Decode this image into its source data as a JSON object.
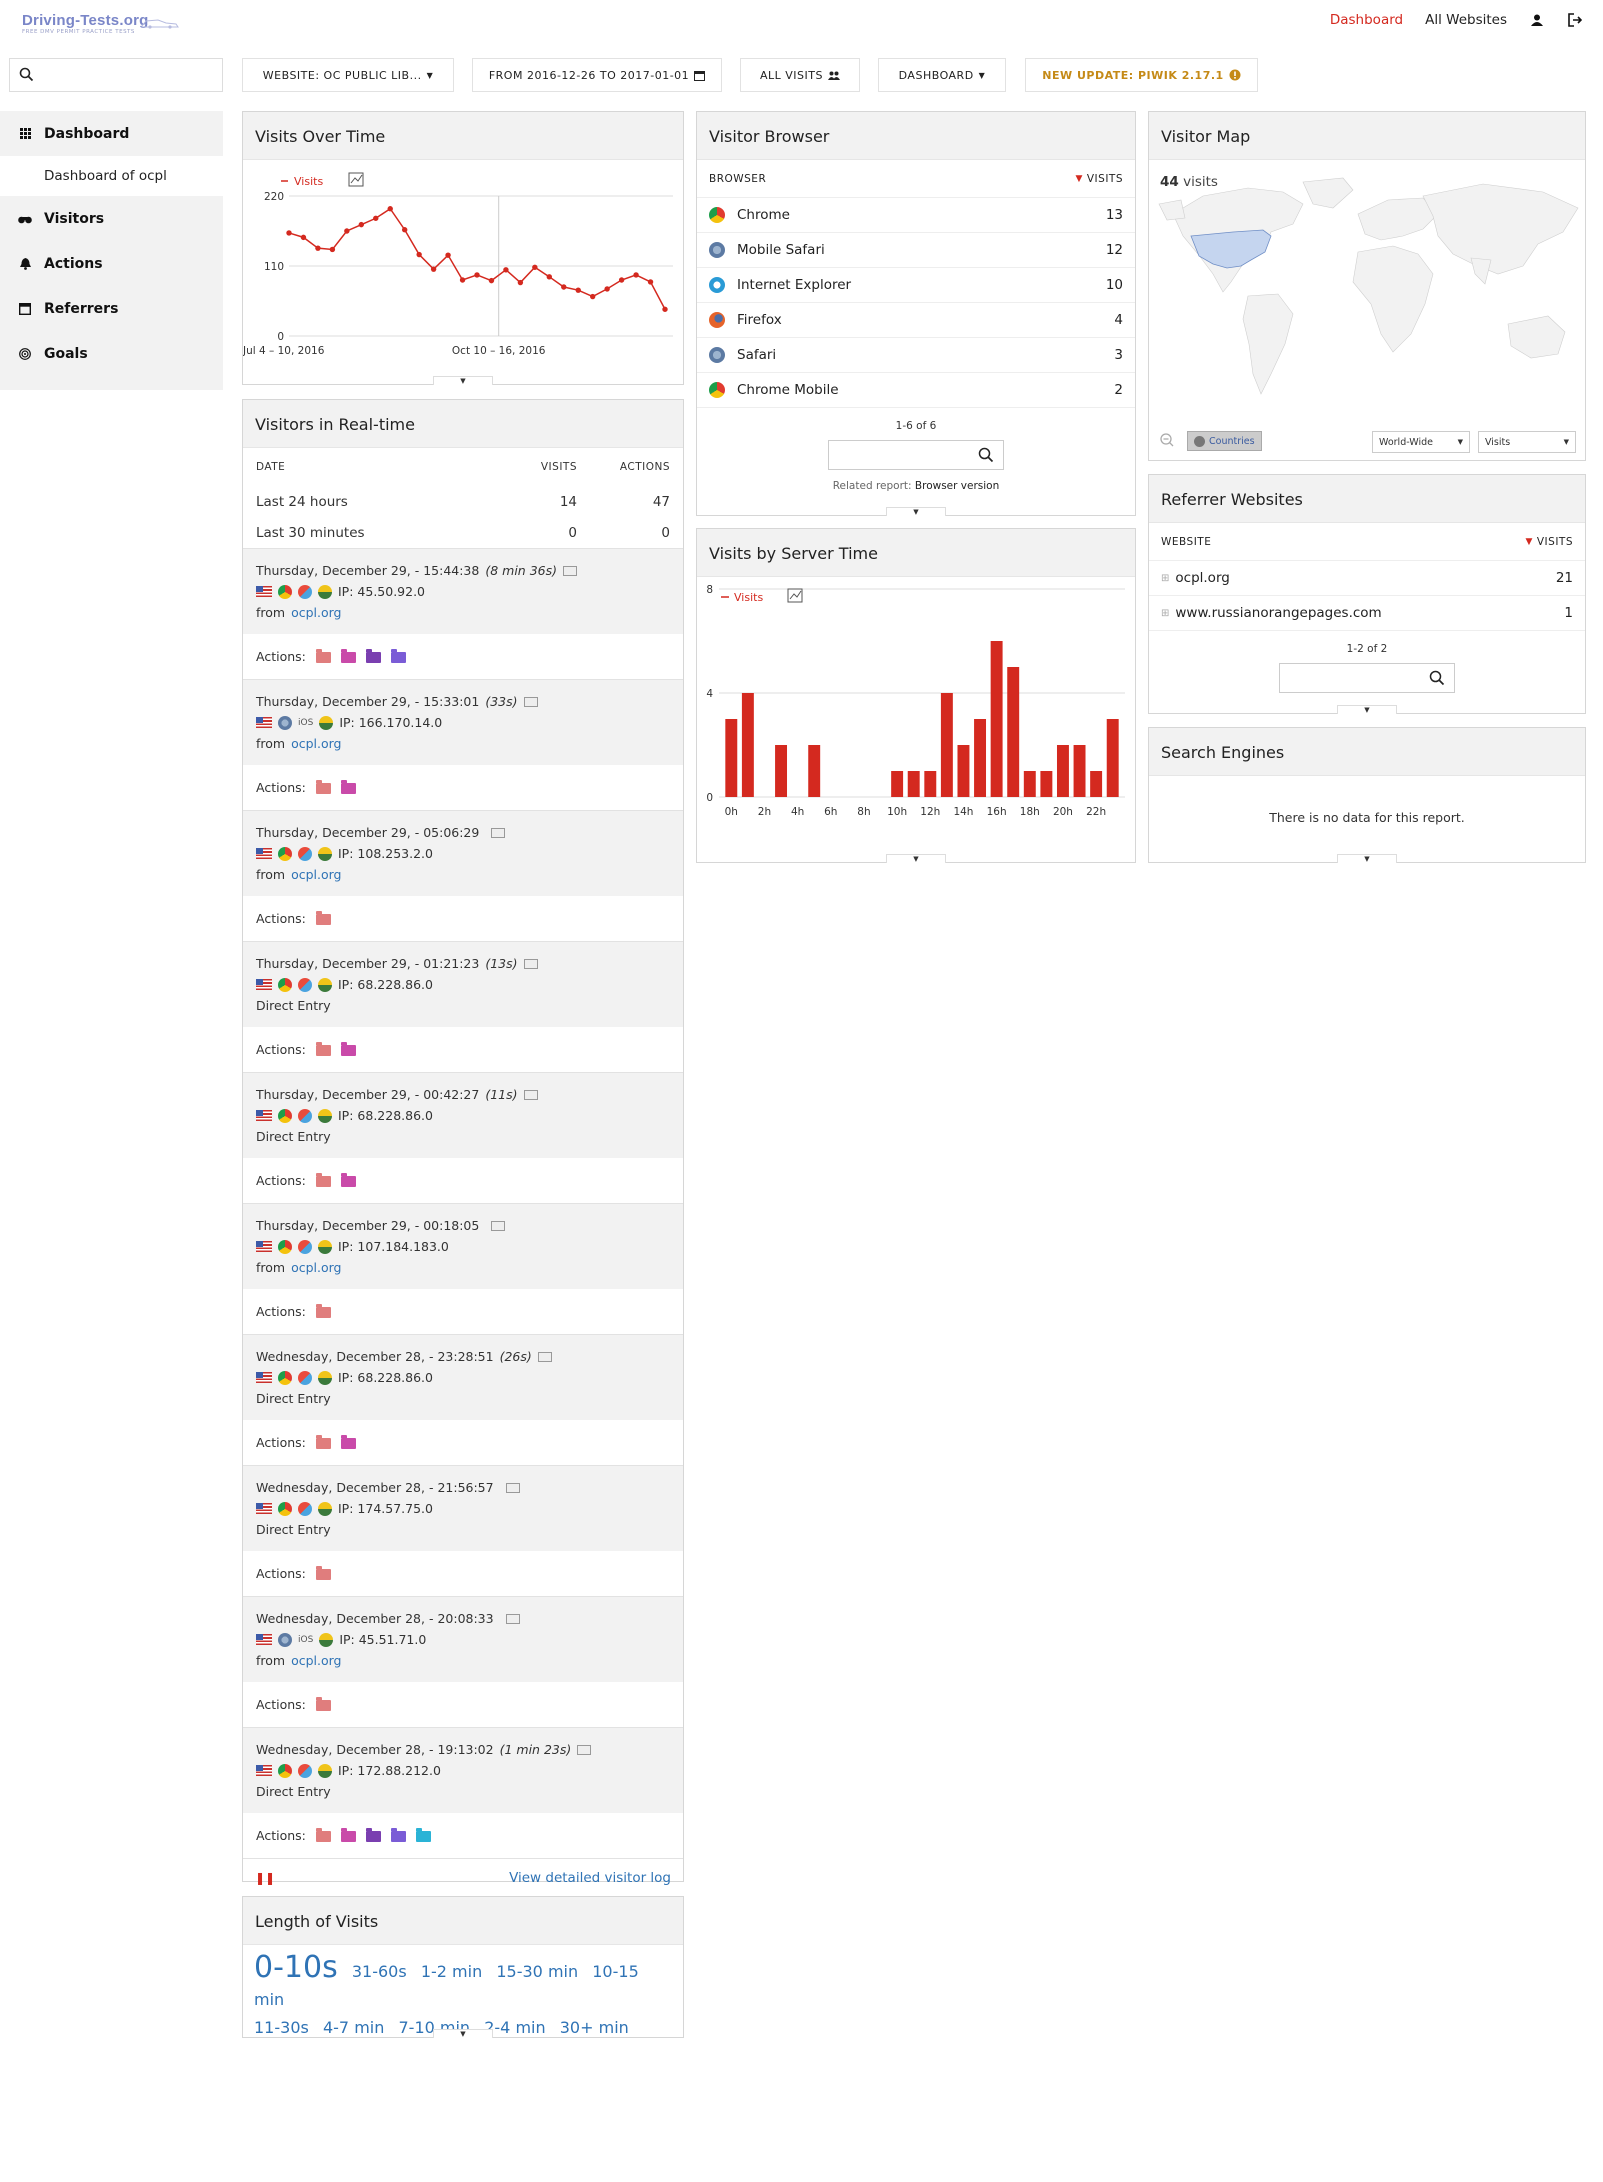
{
  "brand": {
    "title": "Driving-Tests.org",
    "subtitle": "FREE DMV PERMIT PRACTICE TESTS"
  },
  "topnav": {
    "dashboard": "Dashboard",
    "all_websites": "All Websites"
  },
  "toolbar": {
    "website": "WEBSITE: OC PUBLIC LIB...",
    "period": "FROM 2016-12-26 TO 2017-01-01",
    "segment": "ALL VISITS",
    "dashboard": "DASHBOARD",
    "update": "NEW UPDATE: PIWIK 2.17.1"
  },
  "sidebar": {
    "dashboard": "Dashboard",
    "dashboard_sub": "Dashboard of ocpl",
    "items": [
      "Visitors",
      "Actions",
      "Referrers",
      "Goals"
    ]
  },
  "visits_over_time": {
    "title": "Visits Over Time",
    "legend": "Visits",
    "chart_data": {
      "type": "line",
      "series": [
        {
          "name": "Visits",
          "values": [
            162,
            155,
            138,
            136,
            165,
            175,
            185,
            200,
            167,
            128,
            105,
            127,
            88,
            96,
            87,
            104,
            84,
            108,
            93,
            77,
            72,
            62,
            74,
            88,
            96,
            85,
            42
          ]
        }
      ],
      "x_ticks": [
        "Jul 4 – 10, 2016",
        "Oct 10 – 16, 2016"
      ],
      "y_ticks": [
        "220",
        "110",
        "0"
      ],
      "ylim": [
        0,
        220
      ]
    }
  },
  "realtime": {
    "title": "Visitors in Real-time",
    "headers": [
      "DATE",
      "VISITS",
      "ACTIONS"
    ],
    "summary": [
      {
        "label": "Last 24 hours",
        "visits": "14",
        "actions": "47"
      },
      {
        "label": "Last 30 minutes",
        "visits": "0",
        "actions": "0"
      }
    ],
    "visits": [
      {
        "time": "Thursday, December 29, - 15:44:38",
        "dur": "(8 min 36s)",
        "ip": "IP: 45.50.92.0",
        "from": "from",
        "ref": "ocpl.org",
        "folders": 4
      },
      {
        "time": "Thursday, December 29, - 15:33:01",
        "dur": "(33s)",
        "ip": "IP: 166.170.14.0",
        "os": "iOS",
        "from": "from",
        "ref": "ocpl.org",
        "folders": 2
      },
      {
        "time": "Thursday, December 29, - 05:06:29",
        "dur": "",
        "ip": "IP: 108.253.2.0",
        "from": "from",
        "ref": "ocpl.org",
        "folders": 1
      },
      {
        "time": "Thursday, December 29, - 01:21:23",
        "dur": "(13s)",
        "ip": "IP: 68.228.86.0",
        "from": "Direct Entry",
        "ref": "",
        "folders": 2
      },
      {
        "time": "Thursday, December 29, - 00:42:27",
        "dur": "(11s)",
        "ip": "IP: 68.228.86.0",
        "from": "Direct Entry",
        "ref": "",
        "folders": 2
      },
      {
        "time": "Thursday, December 29, - 00:18:05",
        "dur": "",
        "ip": "IP: 107.184.183.0",
        "from": "from",
        "ref": "ocpl.org",
        "folders": 1
      },
      {
        "time": "Wednesday, December 28, - 23:28:51",
        "dur": "(26s)",
        "ip": "IP: 68.228.86.0",
        "from": "Direct Entry",
        "ref": "",
        "folders": 2
      },
      {
        "time": "Wednesday, December 28, - 21:56:57",
        "dur": "",
        "ip": "IP: 174.57.75.0",
        "from": "Direct Entry",
        "ref": "",
        "folders": 1
      },
      {
        "time": "Wednesday, December 28, - 20:08:33",
        "dur": "",
        "ip": "IP: 45.51.71.0",
        "os": "iOS",
        "from": "from",
        "ref": "ocpl.org",
        "folders": 1
      },
      {
        "time": "Wednesday, December 28, - 19:13:02",
        "dur": "(1 min 23s)",
        "ip": "IP: 172.88.212.0",
        "from": "Direct Entry",
        "ref": "",
        "folders": 5
      }
    ],
    "actions_label": "Actions:",
    "view_log": "View detailed visitor log"
  },
  "length_of_visits": {
    "title": "Length of Visits",
    "buckets": [
      "0-10s",
      "31-60s",
      "1-2 min",
      "15-30 min",
      "10-15 min",
      "11-30s",
      "4-7 min",
      "7-10 min",
      "2-4 min",
      "30+ min"
    ]
  },
  "visitor_browser": {
    "title": "Visitor Browser",
    "headers": [
      "BROWSER",
      "VISITS"
    ],
    "rows": [
      {
        "name": "Chrome",
        "visits": "13",
        "icon": "chrome-icon"
      },
      {
        "name": "Mobile Safari",
        "visits": "12",
        "icon": "safari-icon"
      },
      {
        "name": "Internet Explorer",
        "visits": "10",
        "icon": "ie-icon"
      },
      {
        "name": "Firefox",
        "visits": "4",
        "icon": "firefox-icon"
      },
      {
        "name": "Safari",
        "visits": "3",
        "icon": "safari-icon"
      },
      {
        "name": "Chrome Mobile",
        "visits": "2",
        "icon": "chrome-icon"
      }
    ],
    "pager": "1-6 of 6",
    "related_label": "Related report:",
    "related_link": "Browser version"
  },
  "server_time": {
    "title": "Visits by Server Time",
    "legend": "Visits",
    "chart_data": {
      "type": "bar",
      "categories": [
        "0h",
        "1h",
        "2h",
        "3h",
        "4h",
        "5h",
        "6h",
        "7h",
        "8h",
        "9h",
        "10h",
        "11h",
        "12h",
        "13h",
        "14h",
        "15h",
        "16h",
        "17h",
        "18h",
        "19h",
        "20h",
        "21h",
        "22h",
        "23h"
      ],
      "values": [
        3,
        4,
        0,
        2,
        0,
        2,
        0,
        0,
        0,
        0,
        1,
        1,
        1,
        4,
        2,
        3,
        6,
        5,
        1,
        1,
        2,
        2,
        1,
        3
      ],
      "x_ticks": [
        "0h",
        "2h",
        "4h",
        "6h",
        "8h",
        "10h",
        "12h",
        "14h",
        "16h",
        "18h",
        "20h",
        "22h"
      ],
      "y_ticks": [
        "8",
        "4",
        "0"
      ],
      "ylim": [
        0,
        8
      ]
    }
  },
  "visitor_map": {
    "title": "Visitor Map",
    "count": "44",
    "count_label": "visits",
    "mode": "Countries",
    "region": "World-Wide",
    "metric": "Visits"
  },
  "referrer_websites": {
    "title": "Referrer Websites",
    "headers": [
      "WEBSITE",
      "VISITS"
    ],
    "rows": [
      {
        "name": "ocpl.org",
        "visits": "21"
      },
      {
        "name": "www.russianorangepages.com",
        "visits": "1"
      }
    ],
    "pager": "1-2 of 2"
  },
  "search_engines": {
    "title": "Search Engines",
    "empty": "There is no data for this report."
  },
  "colors": {
    "accent": "#d4291f",
    "link": "#2f73b5",
    "update": "#c58a17"
  }
}
